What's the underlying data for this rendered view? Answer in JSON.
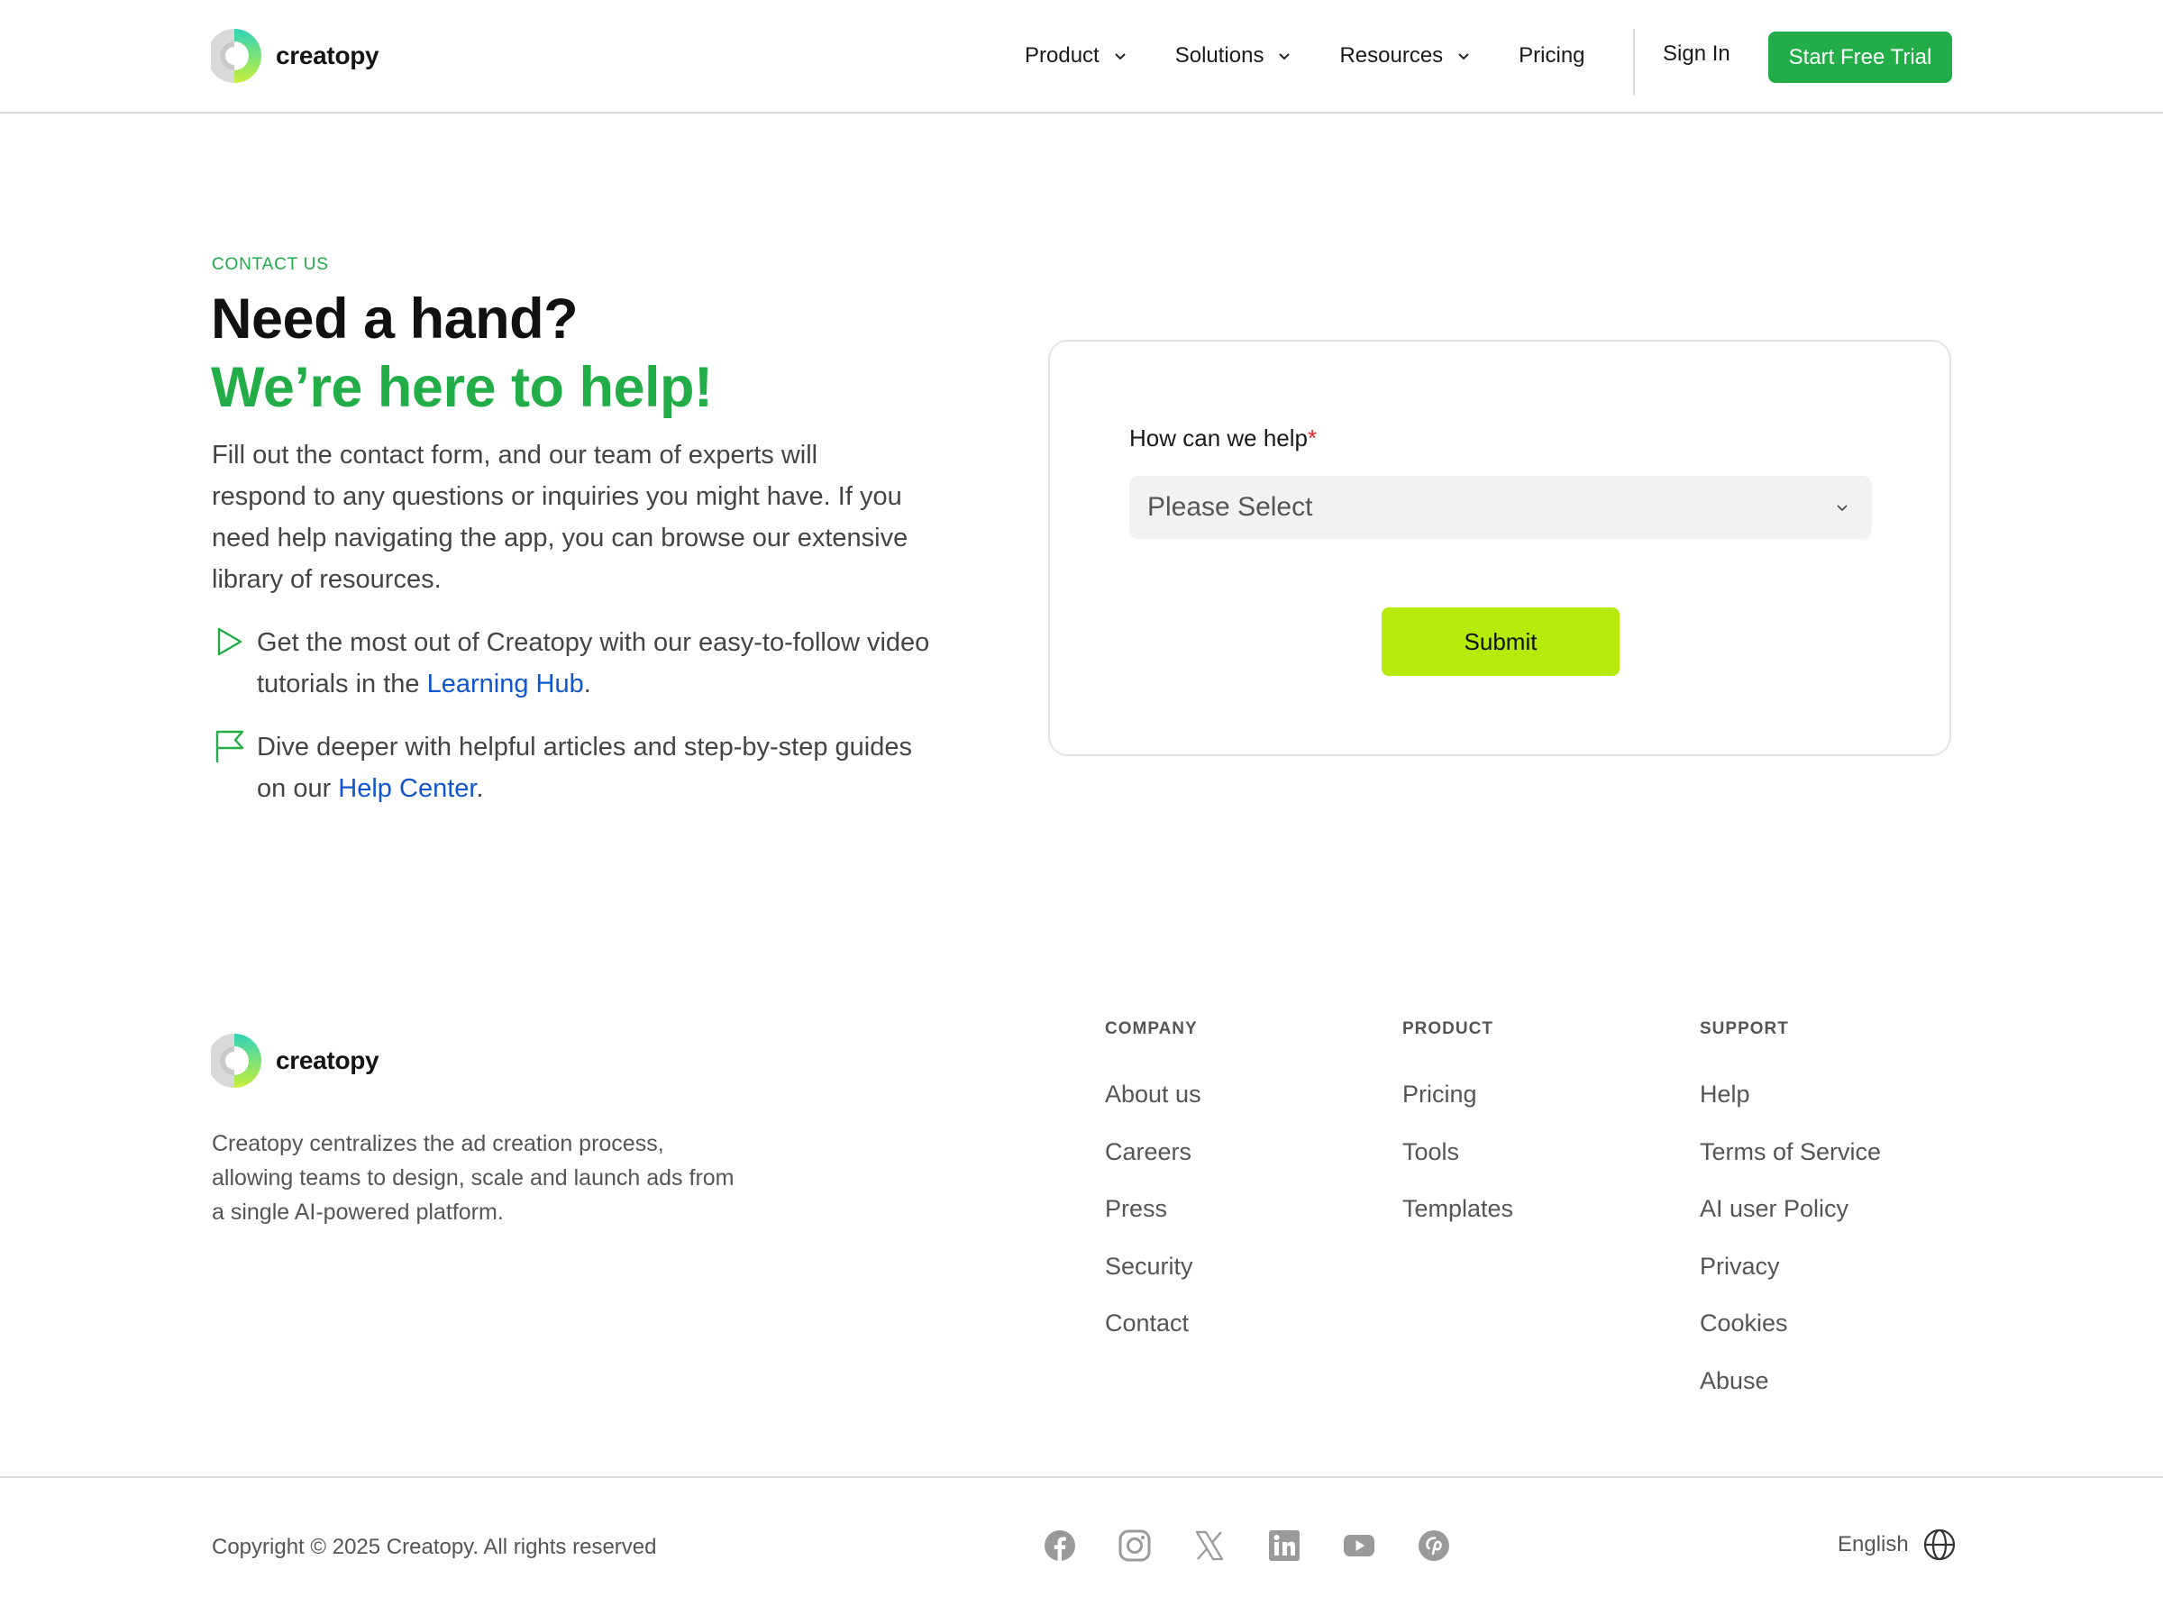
{
  "brand": {
    "name": "creatopy"
  },
  "nav": {
    "items": [
      {
        "label": "Product"
      },
      {
        "label": "Solutions"
      },
      {
        "label": "Resources"
      },
      {
        "label": "Pricing"
      }
    ],
    "sign_in": "Sign In",
    "cta": "Start Free Trial"
  },
  "hero": {
    "eyebrow": "CONTACT US",
    "headline_1": "Need a hand?",
    "headline_2": "We’re here to help!",
    "intro": "Fill out the contact form, and our team of experts will respond to any questions or inquiries you might have. If you need help navigating the app, you can browse our extensive library of resources.",
    "bullets": [
      {
        "icon": "play-icon",
        "text_before": "Get the most out of Creatopy with our easy-to-follow video tutorials in the ",
        "link": "Learning Hub",
        "text_after": "."
      },
      {
        "icon": "flag-icon",
        "text_before": "Dive deeper with helpful articles and step-by-step guides on our ",
        "link": "Help Center",
        "text_after": "."
      }
    ]
  },
  "form": {
    "label": "How can we help",
    "required_mark": "*",
    "select_placeholder": "Please Select",
    "submit": "Submit"
  },
  "footer": {
    "description": "Creatopy centralizes the ad creation process, allowing teams to design, scale and launch ads from a single AI-powered platform.",
    "columns": [
      {
        "heading": "COMPANY",
        "links": [
          "About us",
          "Careers",
          "Press",
          "Security",
          "Contact"
        ]
      },
      {
        "heading": "PRODUCT",
        "links": [
          "Pricing",
          "Tools",
          "Templates"
        ]
      },
      {
        "heading": "SUPPORT",
        "links": [
          "Help",
          "Terms of Service",
          "AI user Policy",
          "Privacy",
          "Cookies",
          "Abuse"
        ]
      }
    ],
    "copyright": "Copyright © 2025 Creatopy. All rights reserved",
    "socials": [
      "facebook-icon",
      "instagram-icon",
      "x-icon",
      "linkedin-icon",
      "youtube-icon",
      "pinterest-icon"
    ],
    "language": "English"
  },
  "colors": {
    "brand_green": "#22ad48",
    "submit_lime": "#b5ea0a",
    "link_blue": "#1256cc",
    "required_red": "#e02424"
  }
}
